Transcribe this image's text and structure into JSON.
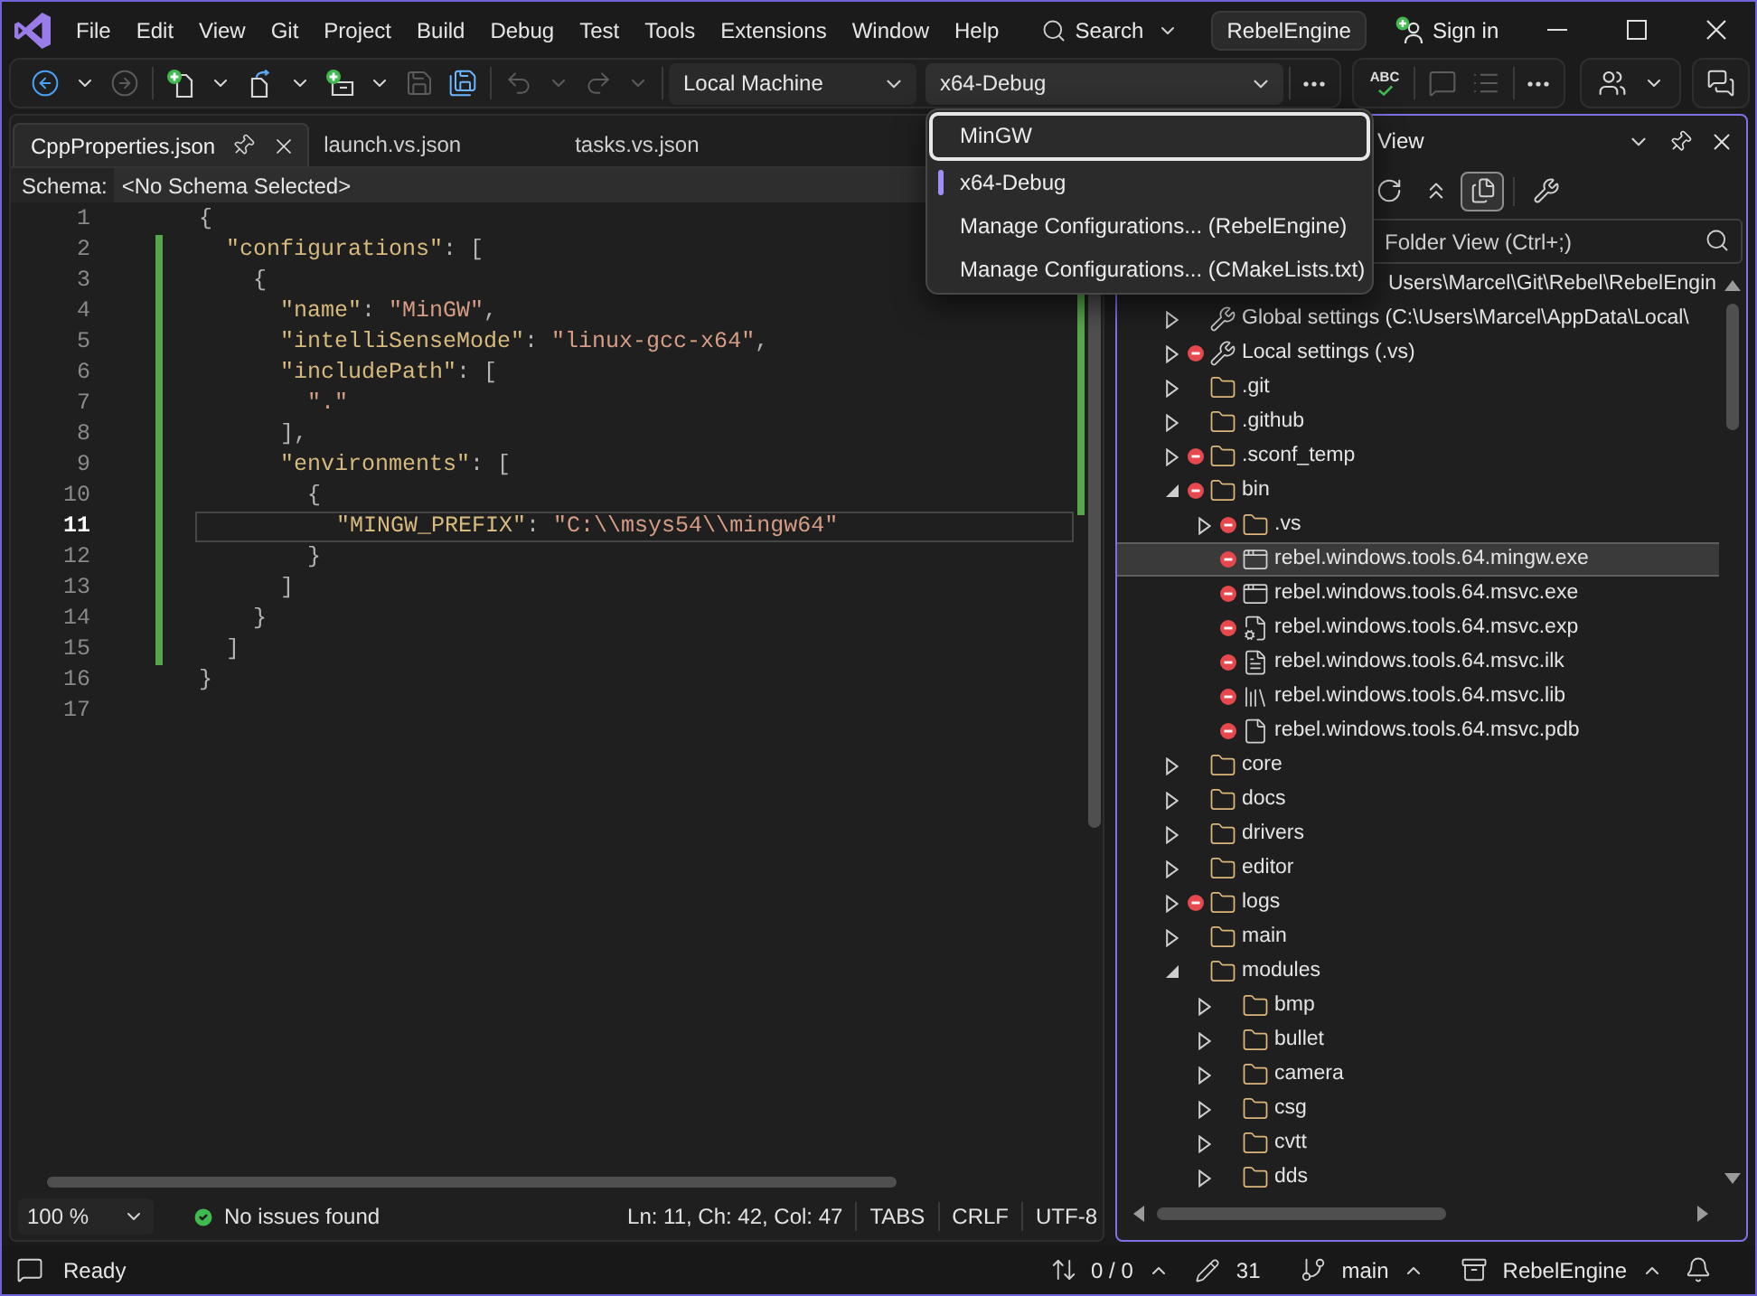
{
  "title_bar": {
    "menu": [
      "File",
      "Edit",
      "View",
      "Git",
      "Project",
      "Build",
      "Debug",
      "Test",
      "Tools",
      "Extensions",
      "Window",
      "Help"
    ],
    "search": "Search",
    "solution": "RebelEngine",
    "sign_in": "Sign in"
  },
  "toolbar": {
    "groups": [
      {
        "items": [
          {
            "kind": "back",
            "disabled": false
          },
          {
            "kind": "dropdown",
            "disabled": false
          },
          {
            "kind": "forward",
            "disabled": true
          },
          {
            "kind": "separator"
          },
          {
            "kind": "new_project",
            "disabled": false
          },
          {
            "kind": "dropdown",
            "disabled": false
          },
          {
            "kind": "open_file",
            "disabled": false
          },
          {
            "kind": "dropdown",
            "disabled": false
          },
          {
            "kind": "add_item",
            "disabled": false
          },
          {
            "kind": "dropdown",
            "disabled": false
          },
          {
            "kind": "save",
            "disabled": true
          },
          {
            "kind": "save_all",
            "disabled": false
          },
          {
            "kind": "separator"
          },
          {
            "kind": "undo",
            "disabled": true
          },
          {
            "kind": "dropdown",
            "disabled": true
          },
          {
            "kind": "redo",
            "disabled": true
          },
          {
            "kind": "dropdown",
            "disabled": true
          },
          {
            "kind": "separator"
          },
          {
            "kind": "combo",
            "value": "Local Machine"
          },
          {
            "kind": "combo",
            "value": "x64-Debug",
            "expanded": true,
            "options": [
              {
                "label": "MinGW",
                "selected": false,
                "focused": true
              },
              {
                "label": "x64-Debug",
                "selected": true,
                "focused": false
              },
              {
                "label": "Manage Configurations... (RebelEngine)",
                "selected": false,
                "focused": false
              },
              {
                "label": "Manage Configurations... (CMakeLists.txt)",
                "selected": false,
                "focused": false
              }
            ]
          },
          {
            "kind": "separator"
          },
          {
            "kind": "more",
            "disabled": false
          }
        ]
      },
      {
        "items": [
          {
            "kind": "spell_check",
            "text": "ABC",
            "disabled": false
          },
          {
            "kind": "separator"
          },
          {
            "kind": "comment",
            "disabled": true
          },
          {
            "kind": "uncomment",
            "disabled": true
          },
          {
            "kind": "separator"
          },
          {
            "kind": "more",
            "disabled": false
          }
        ]
      },
      {
        "items": [
          {
            "kind": "live_share",
            "disabled": false
          },
          {
            "kind": "dropdown",
            "disabled": false
          }
        ]
      },
      {
        "items": [
          {
            "kind": "feedback",
            "disabled": false
          }
        ]
      }
    ]
  },
  "editor": {
    "tabs": [
      {
        "label": "CppProperties.json",
        "selected": true
      },
      {
        "label": "launch.vs.json",
        "selected": false
      },
      {
        "label": "tasks.vs.json",
        "selected": false
      }
    ],
    "schema": {
      "label": "Schema:",
      "value": "<No Schema Selected>"
    },
    "lines": [
      {
        "number": "1",
        "text": "{",
        "changed": false,
        "current": false
      },
      {
        "number": "2",
        "text": "  \"configurations\": [",
        "changed": true,
        "current": false
      },
      {
        "number": "3",
        "text": "    {",
        "changed": true,
        "current": false
      },
      {
        "number": "4",
        "text": "      \"name\": \"MinGW\",",
        "changed": true,
        "current": false
      },
      {
        "number": "5",
        "text": "      \"intelliSenseMode\": \"linux-gcc-x64\",",
        "changed": true,
        "current": false
      },
      {
        "number": "6",
        "text": "      \"includePath\": [",
        "changed": true,
        "current": false
      },
      {
        "number": "7",
        "text": "        \".\"",
        "changed": true,
        "current": false
      },
      {
        "number": "8",
        "text": "      ],",
        "changed": true,
        "current": false
      },
      {
        "number": "9",
        "text": "      \"environments\": [",
        "changed": true,
        "current": false
      },
      {
        "number": "10",
        "text": "        {",
        "changed": true,
        "current": false
      },
      {
        "number": "11",
        "text": "          \"MINGW_PREFIX\": \"C:\\\\msys54\\\\mingw64\"",
        "changed": true,
        "current": true
      },
      {
        "number": "12",
        "text": "        }",
        "changed": true,
        "current": false
      },
      {
        "number": "13",
        "text": "      ]",
        "changed": true,
        "current": false
      },
      {
        "number": "14",
        "text": "    }",
        "changed": true,
        "current": false
      },
      {
        "number": "15",
        "text": "  ]",
        "changed": true,
        "current": false
      },
      {
        "number": "16",
        "text": "}",
        "changed": false,
        "current": false
      },
      {
        "number": "17",
        "changed": false,
        "current": false
      }
    ],
    "footer": {
      "zoom": "100 %",
      "issues": "No issues found",
      "position": "Ln: 11, Ch: 42, Col: 47",
      "indentation": "TABS",
      "line_endings": "CRLF",
      "encoding": "UTF-8"
    }
  },
  "solution_explorer": {
    "title": "View",
    "toolbar": [
      {
        "kind": "refresh",
        "on": false
      },
      {
        "kind": "collapse_all",
        "on": false
      },
      {
        "kind": "show_all_files",
        "on": true
      },
      {
        "kind": "properties",
        "on": false
      }
    ],
    "search": {
      "placeholder": "Folder View (Ctrl+;)"
    },
    "tree": [
      {
        "label": "Users\\Marcel\\Git\\Rebel\\RebelEngin",
        "kind": "root",
        "selected": false,
        "children": [
          {
            "label": "Global settings (C:\\Users\\Marcel\\AppData\\Local\\",
            "kind": "settings",
            "expanded": false,
            "ignored": false,
            "selected": false
          },
          {
            "label": "Local settings (.vs)",
            "kind": "settings",
            "expanded": false,
            "ignored": true,
            "selected": false
          },
          {
            "label": ".git",
            "kind": "folder",
            "expanded": false,
            "ignored": false,
            "selected": false
          },
          {
            "label": ".github",
            "kind": "folder",
            "expanded": false,
            "ignored": false,
            "selected": false
          },
          {
            "label": ".sconf_temp",
            "kind": "folder",
            "expanded": false,
            "ignored": true,
            "selected": false
          },
          {
            "label": "bin",
            "kind": "folder",
            "expanded": true,
            "ignored": true,
            "selected": false,
            "children": [
              {
                "label": ".vs",
                "kind": "folder",
                "expanded": false,
                "ignored": true,
                "selected": false
              },
              {
                "label": "rebel.windows.tools.64.mingw.exe",
                "kind": "exe",
                "ignored": true,
                "selected": true
              },
              {
                "label": "rebel.windows.tools.64.msvc.exe",
                "kind": "exe",
                "ignored": true,
                "selected": false
              },
              {
                "label": "rebel.windows.tools.64.msvc.exp",
                "kind": "exp",
                "ignored": true,
                "selected": false
              },
              {
                "label": "rebel.windows.tools.64.msvc.ilk",
                "kind": "ilk",
                "ignored": true,
                "selected": false
              },
              {
                "label": "rebel.windows.tools.64.msvc.lib",
                "kind": "lib",
                "ignored": true,
                "selected": false
              },
              {
                "label": "rebel.windows.tools.64.msvc.pdb",
                "kind": "pdb",
                "ignored": true,
                "selected": false
              }
            ]
          },
          {
            "label": "core",
            "kind": "folder",
            "expanded": false,
            "ignored": false,
            "selected": false
          },
          {
            "label": "docs",
            "kind": "folder",
            "expanded": false,
            "ignored": false,
            "selected": false
          },
          {
            "label": "drivers",
            "kind": "folder",
            "expanded": false,
            "ignored": false,
            "selected": false
          },
          {
            "label": "editor",
            "kind": "folder",
            "expanded": false,
            "ignored": false,
            "selected": false
          },
          {
            "label": "logs",
            "kind": "folder",
            "expanded": false,
            "ignored": true,
            "selected": false
          },
          {
            "label": "main",
            "kind": "folder",
            "expanded": false,
            "ignored": false,
            "selected": false
          },
          {
            "label": "modules",
            "kind": "folder",
            "expanded": true,
            "ignored": false,
            "selected": false,
            "children": [
              {
                "label": "bmp",
                "kind": "folder",
                "expanded": false,
                "ignored": false,
                "selected": false
              },
              {
                "label": "bullet",
                "kind": "folder",
                "expanded": false,
                "ignored": false,
                "selected": false
              },
              {
                "label": "camera",
                "kind": "folder",
                "expanded": false,
                "ignored": false,
                "selected": false
              },
              {
                "label": "csg",
                "kind": "folder",
                "expanded": false,
                "ignored": false,
                "selected": false
              },
              {
                "label": "cvtt",
                "kind": "folder",
                "expanded": false,
                "ignored": false,
                "selected": false
              },
              {
                "label": "dds",
                "kind": "folder",
                "expanded": false,
                "ignored": false,
                "selected": false
              }
            ]
          }
        ]
      }
    ]
  },
  "status_bar": {
    "message": "Ready",
    "sync": "0 / 0",
    "changes": "31",
    "branch": "main",
    "repository": "RebelEngine"
  }
}
